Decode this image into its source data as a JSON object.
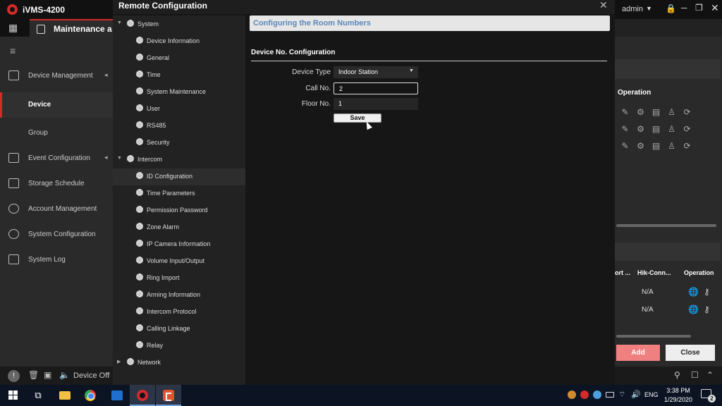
{
  "app": {
    "title": "iVMS-4200",
    "active_tab": "Maintenance a",
    "sidebar": {
      "items": [
        {
          "label": "Device Management",
          "icon": "device-management-icon"
        },
        {
          "label": "Device",
          "icon": ""
        },
        {
          "label": "Group",
          "icon": ""
        },
        {
          "label": "Event Configuration",
          "icon": "event-icon"
        },
        {
          "label": "Storage Schedule",
          "icon": "storage-icon"
        },
        {
          "label": "Account Management",
          "icon": "account-icon"
        },
        {
          "label": "System Configuration",
          "icon": "gear-icon"
        },
        {
          "label": "System Log",
          "icon": "log-icon"
        }
      ]
    },
    "bottom": {
      "device_status": "Device Offli"
    },
    "user": "admin",
    "right_panel": {
      "operation_header": "Operation",
      "table_headers": [
        "ort ...",
        "Hik-Conn...",
        "Operation"
      ],
      "rows": [
        "N/A",
        "N/A"
      ],
      "add_label": "Add",
      "close_label": "Close"
    }
  },
  "dialog": {
    "title": "Remote Configuration",
    "tree": [
      {
        "label": "System",
        "level": 0,
        "expanded": true
      },
      {
        "label": "Device Information",
        "level": 1
      },
      {
        "label": "General",
        "level": 1
      },
      {
        "label": "Time",
        "level": 1
      },
      {
        "label": "System Maintenance",
        "level": 1
      },
      {
        "label": "User",
        "level": 1
      },
      {
        "label": "RS485",
        "level": 1
      },
      {
        "label": "Security",
        "level": 1
      },
      {
        "label": "Intercom",
        "level": 0,
        "expanded": true
      },
      {
        "label": "ID Configuration",
        "level": 1,
        "selected": true
      },
      {
        "label": "Time Parameters",
        "level": 1
      },
      {
        "label": "Permission Password",
        "level": 1
      },
      {
        "label": "Zone Alarm",
        "level": 1
      },
      {
        "label": "IP Camera Information",
        "level": 1
      },
      {
        "label": "Volume Input/Output",
        "level": 1
      },
      {
        "label": "Ring Import",
        "level": 1
      },
      {
        "label": "Arming Information",
        "level": 1
      },
      {
        "label": "Intercom Protocol",
        "level": 1
      },
      {
        "label": "Calling Linkage",
        "level": 1
      },
      {
        "label": "Relay",
        "level": 1
      },
      {
        "label": "Network",
        "level": 0,
        "expanded": false
      }
    ],
    "content": {
      "header": "Configuring the Room Numbers",
      "section_title": "Device No. Configuration",
      "device_type_label": "Device Type",
      "device_type_value": "Indoor Station",
      "call_no_label": "Call No.",
      "call_no_value": "2",
      "floor_no_label": "Floor No.",
      "floor_no_value": "1",
      "save_label": "Save"
    }
  },
  "taskbar": {
    "language": "ENG",
    "time": "3:38 PM",
    "date": "1/29/2020",
    "notification_count": "2"
  },
  "colors": {
    "accent_red": "#d32a2a",
    "header_link_blue": "#5b87b8",
    "add_button": "#f08080"
  }
}
